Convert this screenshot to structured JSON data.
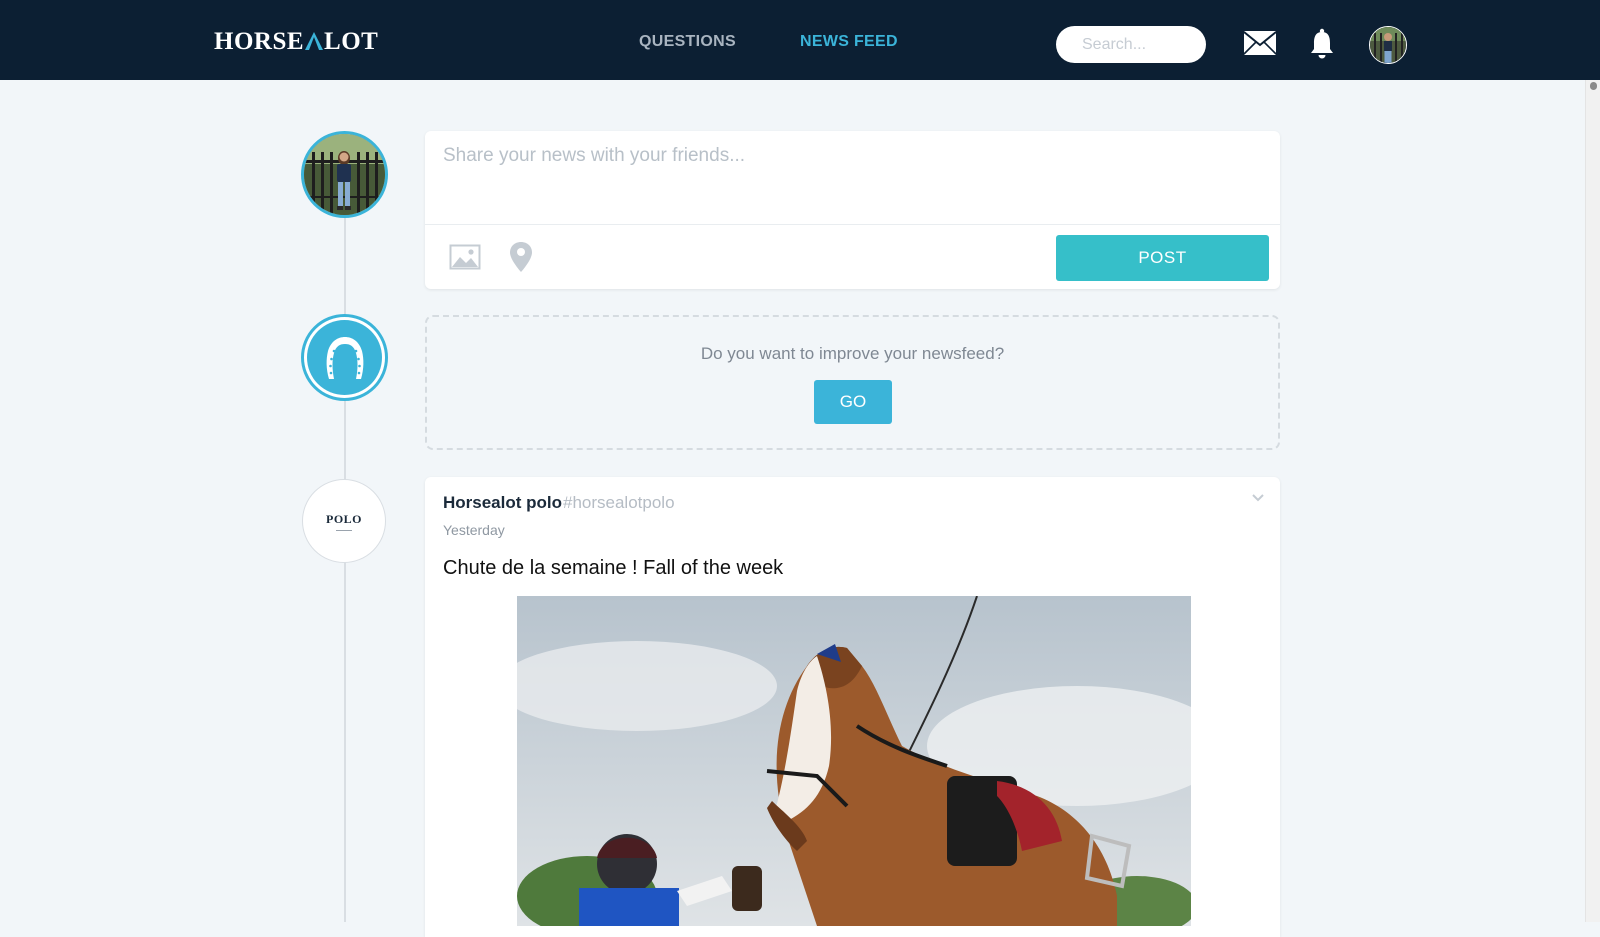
{
  "header": {
    "logo_left": "HORSE",
    "logo_right": "LOT",
    "nav": [
      {
        "label": "QUESTIONS"
      },
      {
        "label": "NEWS FEED"
      }
    ],
    "search": {
      "placeholder": "Search..."
    },
    "icons": [
      "mail-icon",
      "bell-icon",
      "avatar"
    ]
  },
  "composer": {
    "placeholder": "Share your news with your friends...",
    "icons": [
      "photo-icon",
      "location-pin-icon"
    ],
    "post_label": "POST"
  },
  "improve": {
    "text": "Do you want to improve your newsfeed?",
    "go_label": "GO",
    "icon": "horseshoe-icon"
  },
  "post": {
    "author": "Horsealot polo",
    "handle": "#horsealotpolo",
    "time": "Yesterday",
    "text": "Chute de la semaine ! Fall of the week",
    "avatar_text": "POLO"
  },
  "colors": {
    "header_bg": "#0c1f33",
    "accent": "#3bb4d9",
    "post_button": "#36bfc9",
    "page_bg": "#f2f6f9"
  }
}
